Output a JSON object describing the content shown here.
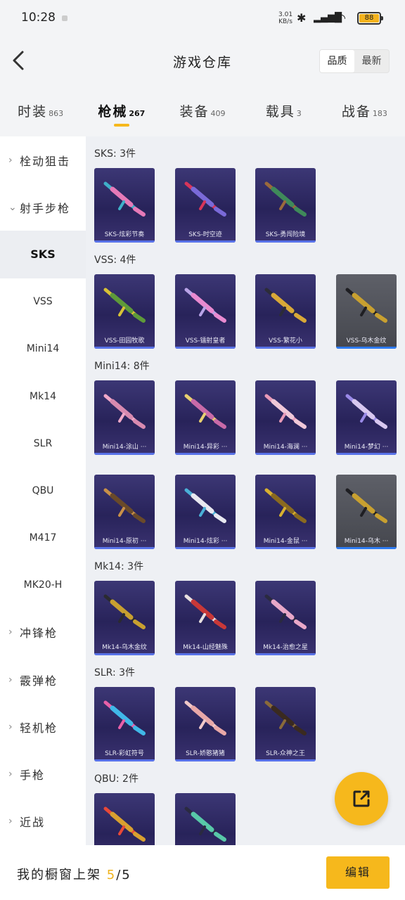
{
  "status": {
    "time": "10:28",
    "speed_value": "3.01",
    "speed_unit": "KB/s",
    "battery": "88"
  },
  "header": {
    "title": "游戏仓库",
    "sort_quality": "品质",
    "sort_latest": "最新"
  },
  "tabs": [
    {
      "label": "时装",
      "count": "863"
    },
    {
      "label": "枪械",
      "count": "267"
    },
    {
      "label": "装备",
      "count": "409"
    },
    {
      "label": "载具",
      "count": "3"
    },
    {
      "label": "战备",
      "count": "183"
    }
  ],
  "sidebar": [
    {
      "label": "栓动狙击"
    },
    {
      "label": "射手步枪"
    },
    {
      "label": "SKS"
    },
    {
      "label": "VSS"
    },
    {
      "label": "Mini14"
    },
    {
      "label": "Mk14"
    },
    {
      "label": "SLR"
    },
    {
      "label": "QBU"
    },
    {
      "label": "M417"
    },
    {
      "label": "MK20-H"
    },
    {
      "label": "冲锋枪"
    },
    {
      "label": "霰弹枪"
    },
    {
      "label": "轻机枪"
    },
    {
      "label": "手枪"
    },
    {
      "label": "近战"
    }
  ],
  "sections": [
    {
      "title": "SKS: 3件",
      "items": [
        "SKS-炫彩节奏",
        "SKS-时空迹",
        "SKS-勇闯险境"
      ]
    },
    {
      "title": "VSS: 4件",
      "items": [
        "VSS-田园牧歌",
        "VSS-镭射皇者",
        "VSS-繁花小",
        "VSS-乌木金纹"
      ]
    },
    {
      "title": "Mini14: 8件",
      "items": [
        "Mini14-涂山 ···",
        "Mini14-异彩 ···",
        "Mini14-海澜 ···",
        "Mini14-梦幻 ···",
        "Mini14-原初 ···",
        "Mini14-炫彩 ···",
        "Mini14-金鼠 ···",
        "Mini14-乌木 ···"
      ]
    },
    {
      "title": "Mk14: 3件",
      "items": [
        "Mk14-乌木金纹",
        "Mk14-山经魅殊",
        "Mk14-治愈之星"
      ]
    },
    {
      "title": "SLR: 3件",
      "items": [
        "SLR-彩虹符号",
        "SLR-娇憨猪猪",
        "SLR-众神之王"
      ]
    },
    {
      "title": "QBU: 2件",
      "items": [
        "",
        ""
      ]
    }
  ],
  "bottom": {
    "label": "我的橱窗上架",
    "shown": "5",
    "total": "/5",
    "edit": "编辑"
  },
  "colors": {
    "accent": "#f6b81c",
    "card_purple": "#2c2760",
    "card_gray": "#4f5158"
  }
}
